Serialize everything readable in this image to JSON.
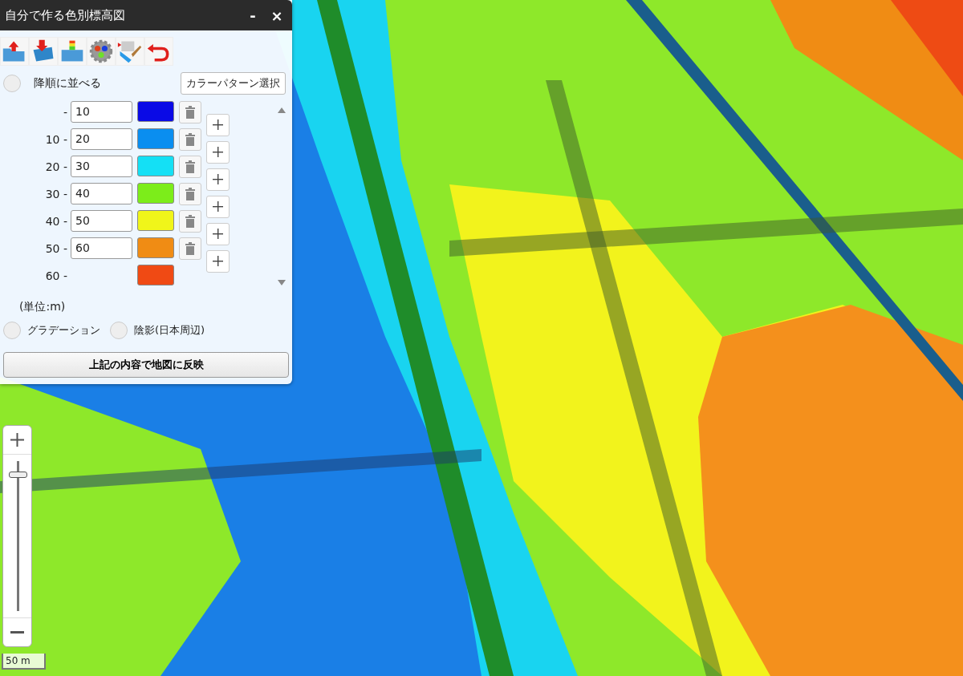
{
  "panel": {
    "title": "自分で作る色別標高図",
    "minimize": "-",
    "close": "×"
  },
  "sort_descending": {
    "label": "降順に並べる",
    "checked": false
  },
  "color_pattern_button": "カラーパターン選択",
  "ranges": [
    {
      "label": "-",
      "value": "10",
      "color": "#0a0ae6"
    },
    {
      "label": "10 -",
      "value": "20",
      "color": "#0a8ef0"
    },
    {
      "label": "20 -",
      "value": "30",
      "color": "#14e0f5"
    },
    {
      "label": "30 -",
      "value": "40",
      "color": "#7ced1a"
    },
    {
      "label": "40 -",
      "value": "50",
      "color": "#f0f51a"
    },
    {
      "label": "50 -",
      "value": "60",
      "color": "#f08c14"
    },
    {
      "label": "60 -",
      "color": "#f04a14"
    }
  ],
  "unit": "(単位:m)",
  "options": [
    {
      "label": "グラデーション",
      "checked": false
    },
    {
      "label": "陰影(日本周辺)",
      "checked": false
    }
  ],
  "apply_button": "上記の内容で地図に反映",
  "zoom": {
    "level": 0.93
  },
  "scale": "50 m"
}
